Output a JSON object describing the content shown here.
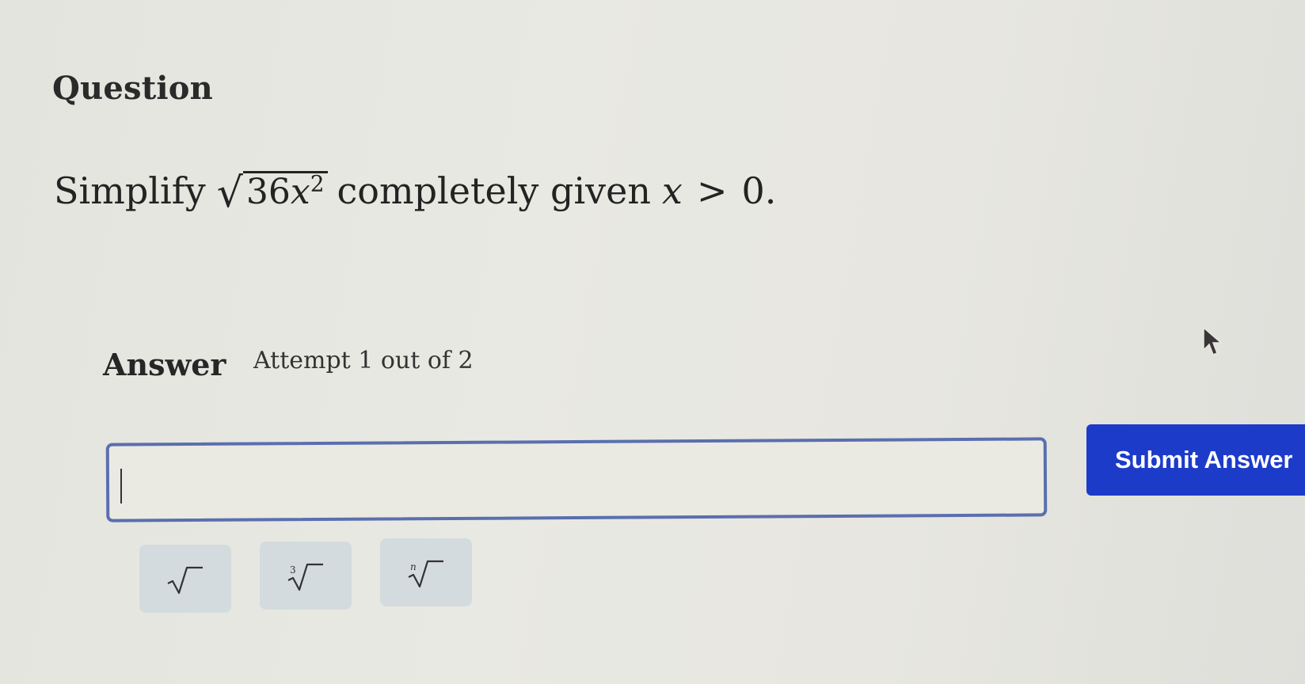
{
  "question": {
    "heading": "Question",
    "prompt_prefix": "Simplify",
    "radicand_coefficient": "36",
    "radicand_variable": "x",
    "radicand_exponent": "2",
    "prompt_middle": "completely given",
    "condition_variable": "x",
    "condition_operator": ">",
    "condition_value": "0."
  },
  "answer": {
    "label": "Answer",
    "attempt_text": "Attempt 1 out of 2",
    "input_value": ""
  },
  "submit": {
    "label": "Submit Answer"
  },
  "math_tools": [
    {
      "name": "square-root-icon"
    },
    {
      "name": "cube-root-icon",
      "index": "3"
    },
    {
      "name": "nth-root-icon",
      "index": "n"
    }
  ],
  "colors": {
    "submit_bg": "#1d3bc9",
    "input_border": "#5a6fae",
    "tool_bg": "#d4dbde"
  }
}
